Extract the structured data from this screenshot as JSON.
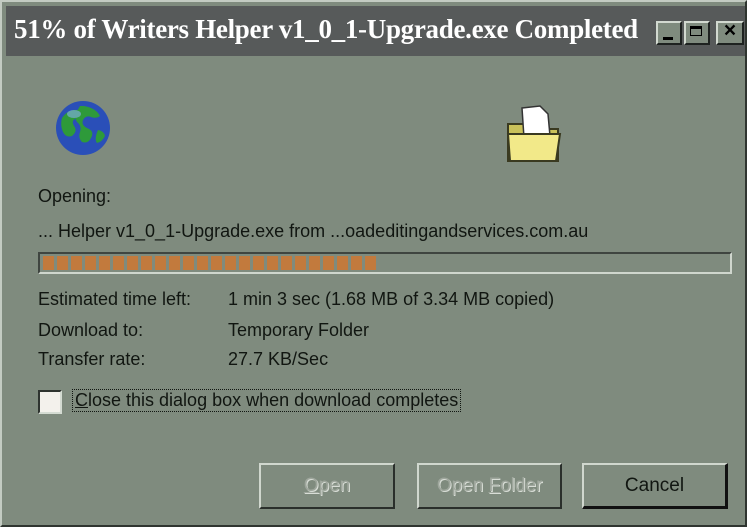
{
  "window": {
    "title": "51% of Writers Helper v1_0_1-Upgrade.exe Completed",
    "controls": {
      "close_glyph": "×"
    }
  },
  "icons": {
    "source": "globe-icon",
    "destination": "folder-icon"
  },
  "status": {
    "opening_label": "Opening:",
    "file_line": "... Helper v1_0_1-Upgrade.exe from ...oadeditingandservices.com.au"
  },
  "progress": {
    "percent": 51,
    "color": "#c27a3d"
  },
  "details": [
    {
      "label": "Estimated time left:",
      "value": "1 min 3 sec (1.68 MB of 3.34 MB copied)"
    },
    {
      "label": "Download to:",
      "value": "Temporary Folder"
    },
    {
      "label": "Transfer rate:",
      "value": "27.7 KB/Sec"
    }
  ],
  "close_on_complete": {
    "label_first": "C",
    "label_rest": "lose this dialog box when download completes",
    "checked": false
  },
  "buttons": {
    "open": {
      "first": "O",
      "rest": "pen",
      "enabled": false
    },
    "open_folder": {
      "prefix": "Open ",
      "first": "F",
      "rest": "older",
      "enabled": false
    },
    "cancel": {
      "label": "Cancel",
      "enabled": true
    }
  }
}
